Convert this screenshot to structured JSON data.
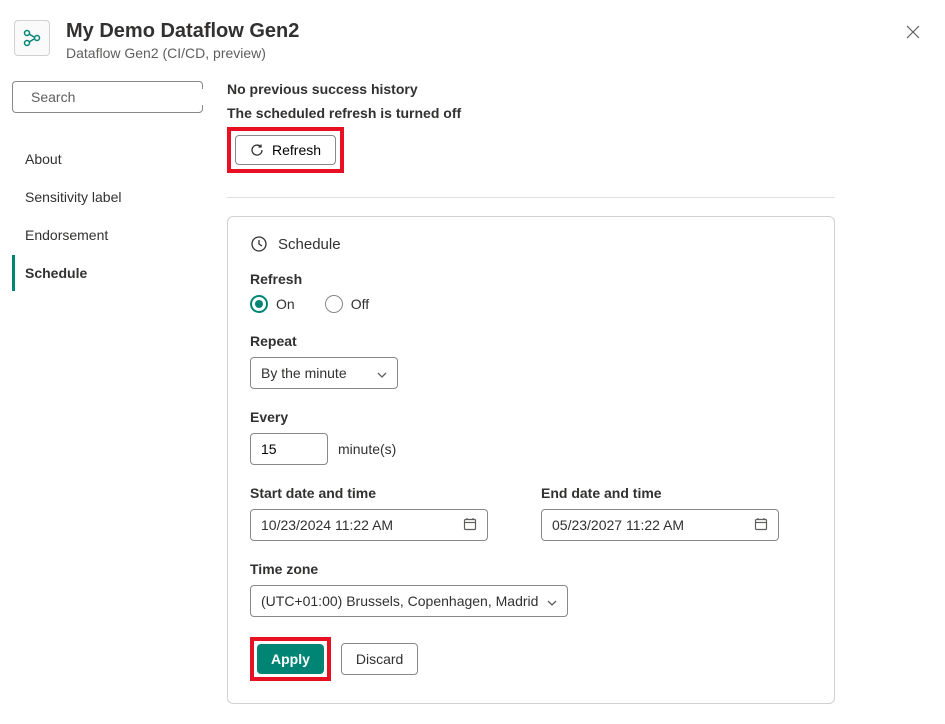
{
  "header": {
    "title": "My Demo Dataflow Gen2",
    "subtitle": "Dataflow Gen2 (CI/CD, preview)"
  },
  "search": {
    "placeholder": "Search"
  },
  "nav": {
    "items": [
      {
        "label": "About"
      },
      {
        "label": "Sensitivity label"
      },
      {
        "label": "Endorsement"
      },
      {
        "label": "Schedule"
      }
    ],
    "active_index": 3
  },
  "status": {
    "no_history": "No previous success history",
    "sched_off": "The scheduled refresh is turned off",
    "refresh_label": "Refresh"
  },
  "schedule": {
    "header_label": "Schedule",
    "refresh_label": "Refresh",
    "radio_on": "On",
    "radio_off": "Off",
    "radio_selected": "on",
    "repeat_label": "Repeat",
    "repeat_value": "By the minute",
    "every_label": "Every",
    "every_value": "15",
    "every_unit": "minute(s)",
    "start_label": "Start date and time",
    "start_value": "10/23/2024  11:22 AM",
    "end_label": "End date and time",
    "end_value": "05/23/2027  11:22 AM",
    "tz_label": "Time zone",
    "tz_value": "(UTC+01:00) Brussels, Copenhagen, Madrid",
    "apply_label": "Apply",
    "discard_label": "Discard"
  },
  "colors": {
    "accent": "#008575",
    "highlight": "#e81123"
  }
}
